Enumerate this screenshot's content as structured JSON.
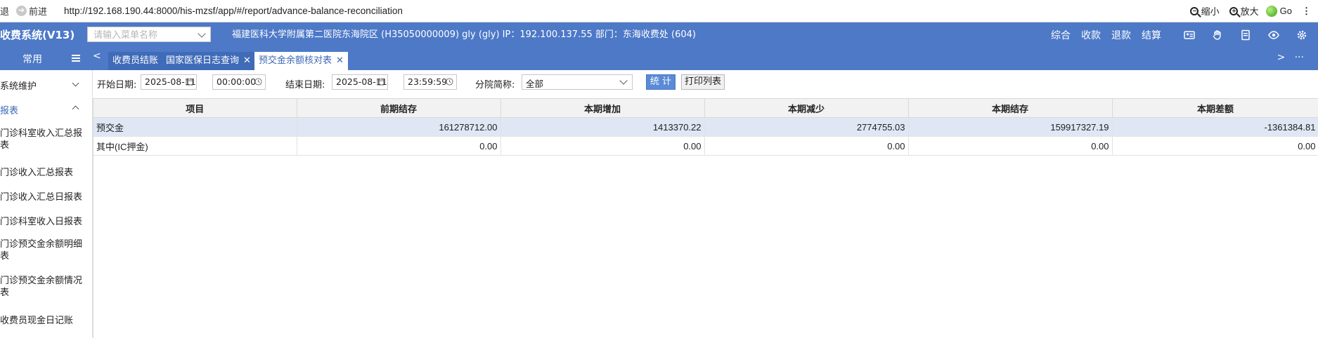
{
  "browser": {
    "back_label": "退",
    "forward_label": "前进",
    "url": "http://192.168.190.44:8000/his-mzsf/app/#/report/advance-balance-reconciliation",
    "zoom_out_label": "缩小",
    "zoom_in_label": "放大",
    "go_label": "Go"
  },
  "header": {
    "app_title": "收费系统(V13)",
    "menu_search_placeholder": "请输入菜单名称",
    "hospital_info": "福建医科大学附属第二医院东海院区 (H35050000009) gly (gly) IP：192.100.137.55 部门：东海收费处 (604)",
    "actions": [
      "综合",
      "收款",
      "退款",
      "结算"
    ]
  },
  "sidebar": {
    "tab_common": "常用",
    "items": [
      {
        "label": "系统维护",
        "expanded": false
      },
      {
        "label": "报表",
        "expanded": true,
        "active": true
      },
      {
        "label": "门诊科室收入汇总报表",
        "line1": "门诊科室收入汇总报",
        "line2": "表"
      },
      {
        "label": "门诊收入汇总报表"
      },
      {
        "label": "门诊收入汇总日报表"
      },
      {
        "label": "门诊科室收入日报表"
      },
      {
        "label": "门诊预交金余额明细表",
        "line1": "门诊预交金余额明细",
        "line2": "表"
      },
      {
        "label": "门诊预交金余额情况表",
        "line1": "门诊预交金余额情况",
        "line2": "表"
      },
      {
        "label": "收费员现金日记账"
      }
    ]
  },
  "tabs": [
    {
      "label": "收费员结账",
      "closable": false,
      "active": false
    },
    {
      "label": "国家医保日志查询",
      "closable": true,
      "active": false
    },
    {
      "label": "预交金余额核对表",
      "closable": true,
      "active": true
    }
  ],
  "filters": {
    "start_label": "开始日期:",
    "start_date": "2025-08-11",
    "start_time": "00:00:00",
    "end_label": "结束日期:",
    "end_date": "2025-08-11",
    "end_time": "23:59:59",
    "branch_label": "分院简称:",
    "branch_value": "全部",
    "stat_button": "统 计",
    "print_button": "打印列表"
  },
  "table": {
    "columns": [
      "项目",
      "前期结存",
      "本期增加",
      "本期减少",
      "本期结存",
      "本期差额"
    ],
    "rows": [
      [
        "预交金",
        "161278712.00",
        "1413370.22",
        "2774755.03",
        "159917327.19",
        "-1361384.81"
      ],
      [
        "其中(IC押金)",
        "0.00",
        "0.00",
        "0.00",
        "0.00",
        "0.00"
      ]
    ]
  },
  "colors": {
    "header_blue": "#4d79c7",
    "active_tab_text": "#3b67b5",
    "selected_row": "#dfe7f4",
    "stat_button": "#5b8ad6"
  }
}
